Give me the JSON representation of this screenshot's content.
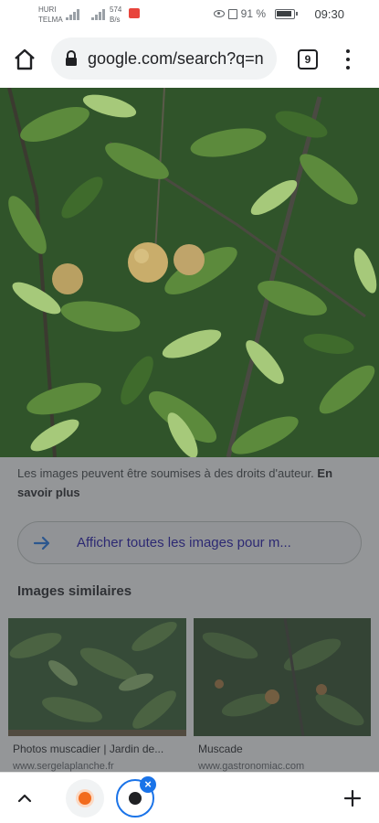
{
  "status_bar": {
    "carrier_line1": "HURI",
    "carrier_line2": "TELMA",
    "speed_value": "574",
    "speed_unit": "B/s",
    "battery": "91 %",
    "time": "09:30"
  },
  "toolbar": {
    "url": "google.com/search?q=n",
    "tab_count": "9"
  },
  "image_viewer": {
    "copyright_notice": "Les images peuvent être soumises à des droits d'auteur.",
    "learn_more": "En savoir plus",
    "show_all_label": "Afficher toutes les images pour m..."
  },
  "similar": {
    "heading": "Images similaires",
    "items": [
      {
        "title": "Photos muscadier | Jardin de...",
        "domain": "www.sergelaplanche.fr"
      },
      {
        "title": "Muscade",
        "domain": "www.gastronomiac.com"
      }
    ]
  },
  "colors": {
    "link_blue": "#1a0dab",
    "accent_blue": "#1a73e8"
  }
}
